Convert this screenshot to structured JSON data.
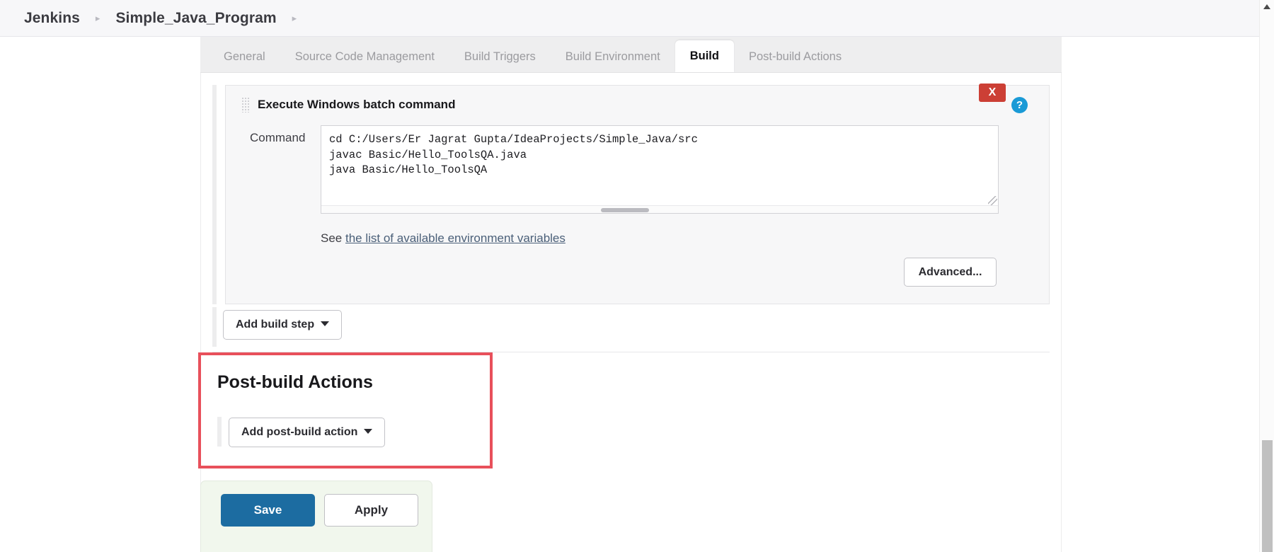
{
  "breadcrumb": {
    "items": [
      {
        "label": "Jenkins"
      },
      {
        "label": "Simple_Java_Program"
      }
    ],
    "separator": "▸"
  },
  "tabs": [
    {
      "label": "General",
      "active": false
    },
    {
      "label": "Source Code Management",
      "active": false
    },
    {
      "label": "Build Triggers",
      "active": false
    },
    {
      "label": "Build Environment",
      "active": false
    },
    {
      "label": "Build",
      "active": true
    },
    {
      "label": "Post-build Actions",
      "active": false
    }
  ],
  "build_step": {
    "title": "Execute Windows batch command",
    "delete_label": "X",
    "help_label": "?",
    "command_label": "Command",
    "command_value": "cd C:/Users/Er Jagrat Gupta/IdeaProjects/Simple_Java/src\njavac Basic/Hello_ToolsQA.java\njava Basic/Hello_ToolsQA",
    "env_prefix": "See ",
    "env_link_label": "the list of available environment variables",
    "advanced_label": "Advanced..."
  },
  "add_build_step": {
    "label": "Add build step"
  },
  "post_build": {
    "heading": "Post-build Actions",
    "add_action_label": "Add post-build action",
    "highlight_color": "#e8505b"
  },
  "footer": {
    "save_label": "Save",
    "apply_label": "Apply",
    "save_color": "#1c6ca1"
  }
}
